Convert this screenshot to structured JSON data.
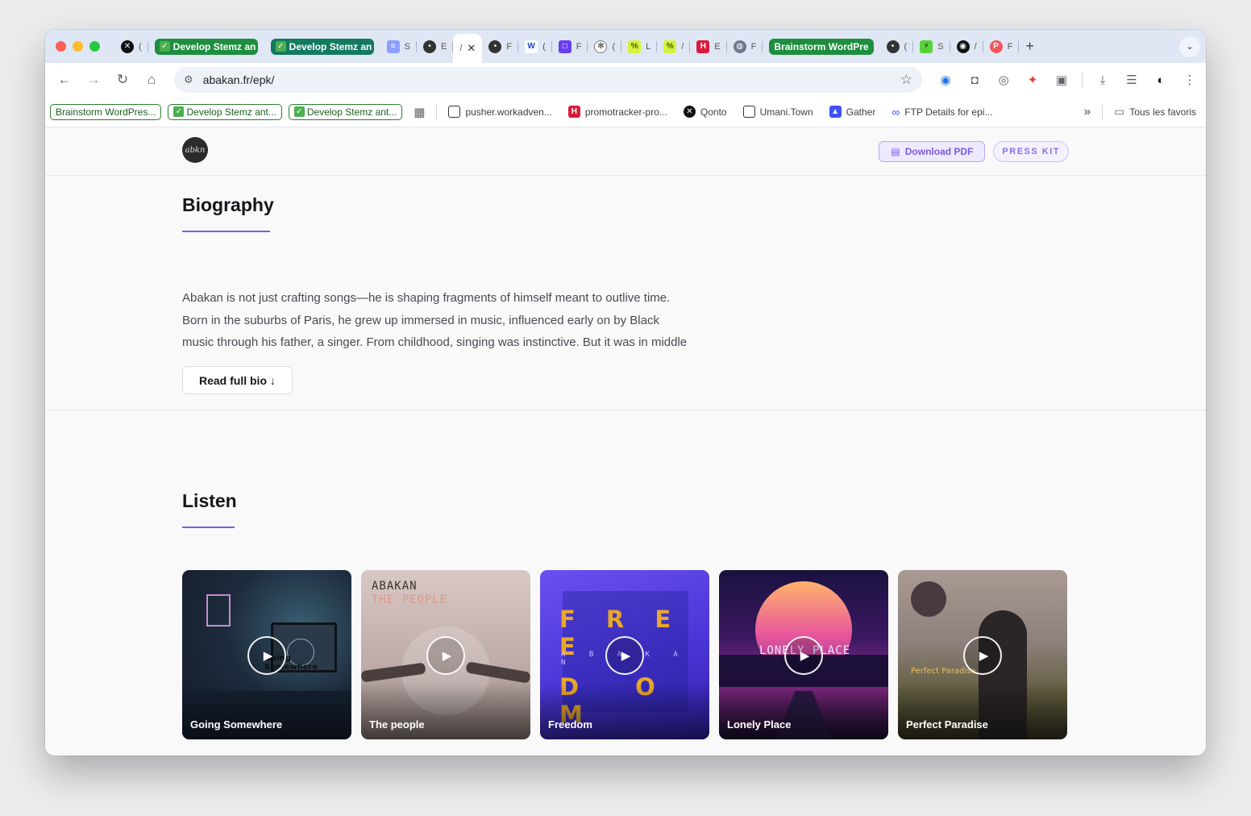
{
  "tabs": {
    "groups": [
      "Develop Stemz an",
      "Develop Stemz an",
      "Brainstorm WordPre"
    ],
    "letters": [
      "(",
      "S",
      "E",
      "/",
      "F",
      "(",
      "F",
      "(",
      "L",
      "/",
      "E",
      "F",
      "(",
      "S",
      "/",
      "F"
    ],
    "new_tab": "+",
    "menu": "⌄"
  },
  "toolbar": {
    "url": "abakan.fr/epk/"
  },
  "bookmarks": {
    "items": [
      "Brainstorm WordPres...",
      "Develop Stemz ant...",
      "Develop Stemz ant...",
      "pusher.workadven...",
      "promotracker-pro...",
      "Qonto",
      "Umani.Town",
      "Gather",
      "FTP Details for epi...",
      "Tous les favoris"
    ],
    "more": "»"
  },
  "header": {
    "logo_text": "abkn",
    "download_label": "Download PDF",
    "press_kit_label": "PRESS KIT"
  },
  "bio": {
    "title": "Biography",
    "lines": [
      "Abakan is not just crafting songs—he is shaping fragments of himself meant to outlive time.",
      "Born in the suburbs of Paris, he grew up immersed in music, influenced early on by Black",
      "music through his father, a singer. From childhood, singing was instinctive. But it was in middle"
    ],
    "read_more": "Read full bio ↓"
  },
  "listen": {
    "title": "Listen",
    "tracks": [
      {
        "title": "Going Somewhere",
        "art_text": "Going Somewhere"
      },
      {
        "title": "The people",
        "art_text": "ABAKAN",
        "art_sub": "THE PEOPLE"
      },
      {
        "title": "Freedom",
        "art_text": "F R E E",
        "art_sub": "D O M",
        "art_mid": "A B A K A N"
      },
      {
        "title": "Lonely Place",
        "art_text": "LONELY PLACE"
      },
      {
        "title": "Perfect Paradise",
        "art_text": "Perfect Paradise"
      }
    ]
  },
  "colors": {
    "accent": "#7c5ce6",
    "group_green": "#1e8e3e",
    "group_teal": "#137a5f"
  }
}
